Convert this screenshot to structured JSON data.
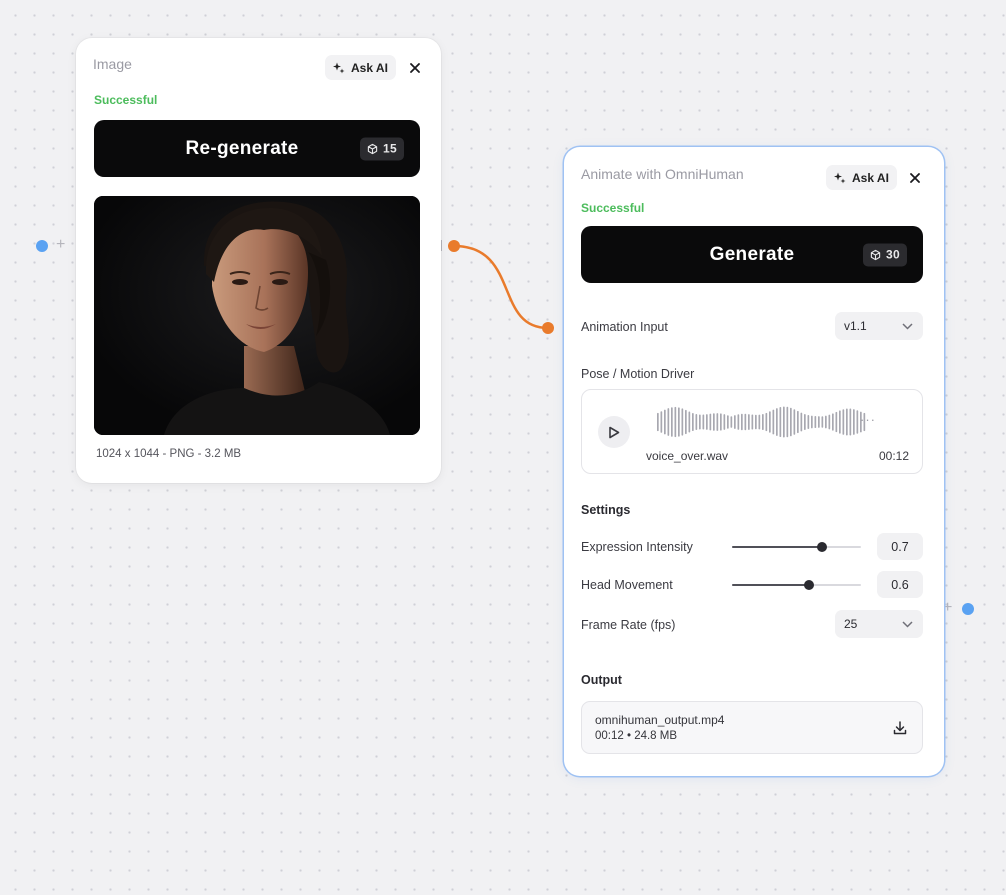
{
  "colors": {
    "accent_blue": "#5aa2f2",
    "connection_orange": "#e97b2c",
    "success_green": "#4cbc5c",
    "button_black": "#0a0a0b",
    "node_selected_border": "#9fc2f3"
  },
  "image_node": {
    "title": "Image",
    "ask_ai_label": "Ask AI",
    "ask_ai_icon": "sparkle-icon",
    "close_icon": "close-icon",
    "status": "Successful",
    "action_label": "Re-generate",
    "cost_icon": "cube-icon",
    "cost": "15",
    "image_meta": "1024 x 1044 - PNG - 3.2 MB"
  },
  "animate_node": {
    "title": "Animate with OmniHuman",
    "ask_ai_label": "Ask AI",
    "ask_ai_icon": "sparkle-icon",
    "close_icon": "close-icon",
    "status": "Successful",
    "action_label": "Generate",
    "cost_icon": "cube-icon",
    "cost": "30",
    "animation_input": {
      "label": "Animation Input",
      "selected": "v1.1"
    },
    "pose_driver": {
      "label": "Pose / Motion Driver",
      "play_icon": "play-icon",
      "filename": "voice_over.wav",
      "duration": "00:12",
      "more_indicator": "···"
    },
    "settings": {
      "label": "Settings",
      "expression_intensity": {
        "label": "Expression Intensity",
        "value": "0.7",
        "level": 0.7
      },
      "head_movement": {
        "label": "Head Movement",
        "value": "0.6",
        "level": 0.6
      },
      "frame_rate": {
        "label": "Frame Rate (fps)",
        "selected": "25"
      }
    },
    "output": {
      "label": "Output",
      "filename": "omnihuman_output.mp4",
      "meta": "00:12 • 24.8 MB",
      "download_icon": "download-icon"
    }
  },
  "canvas": {
    "add_port_icon": "+"
  }
}
